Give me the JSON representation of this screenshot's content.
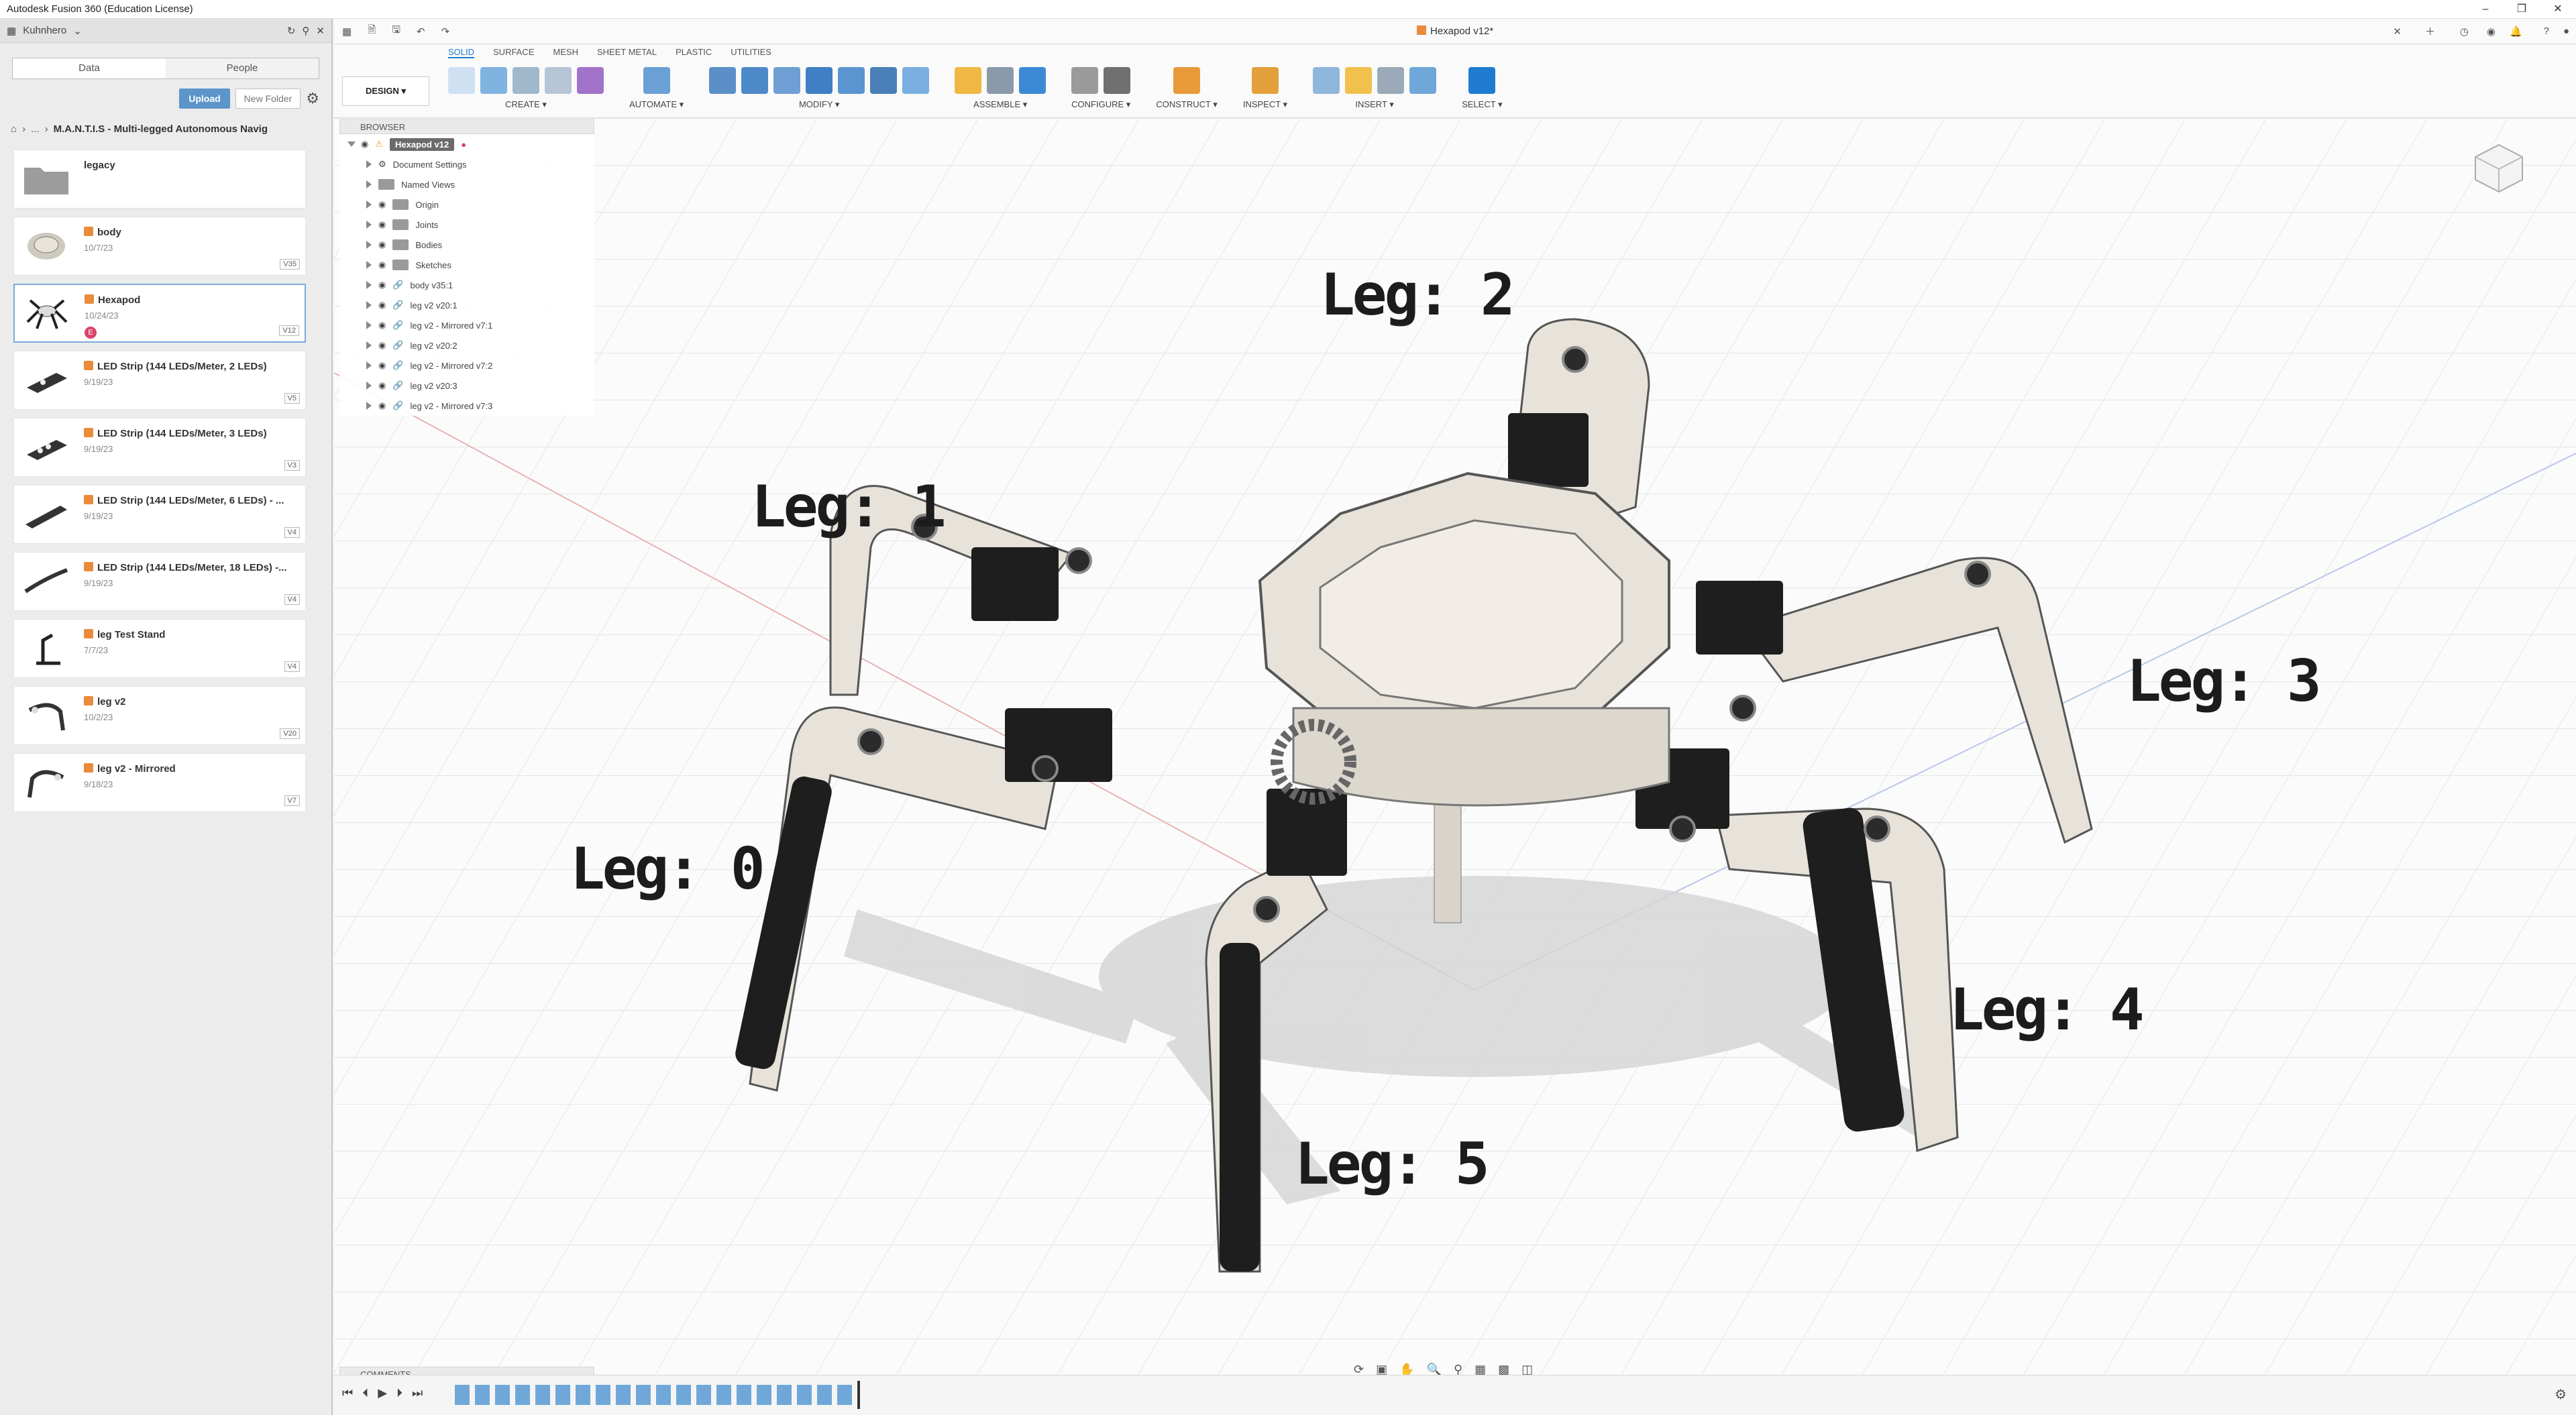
{
  "window": {
    "title": "Autodesk Fusion 360 (Education License)"
  },
  "data_panel": {
    "user": "Kuhnhero",
    "tabs": [
      "Data",
      "People"
    ],
    "upload_label": "Upload",
    "new_folder_label": "New Folder",
    "breadcrumb_ellipsis": "...",
    "breadcrumb_project": "M.A.N.T.I.S - Multi-legged Autonomous Navig",
    "items": [
      {
        "name": "legacy",
        "date": "",
        "version": "",
        "kind": "folder"
      },
      {
        "name": "body",
        "date": "10/7/23",
        "version": "V35"
      },
      {
        "name": "Hexapod",
        "date": "10/24/23",
        "version": "V12",
        "selected": true,
        "badge": "E"
      },
      {
        "name": "LED Strip (144 LEDs/Meter, 2 LEDs)",
        "date": "9/19/23",
        "version": "V5"
      },
      {
        "name": "LED Strip (144 LEDs/Meter, 3 LEDs)",
        "date": "9/19/23",
        "version": "V3"
      },
      {
        "name": "LED Strip (144 LEDs/Meter, 6 LEDs) - ...",
        "date": "9/19/23",
        "version": "V4"
      },
      {
        "name": "LED Strip (144 LEDs/Meter, 18 LEDs) -...",
        "date": "9/19/23",
        "version": "V4"
      },
      {
        "name": "leg Test Stand",
        "date": "7/7/23",
        "version": "V4"
      },
      {
        "name": "leg v2",
        "date": "10/2/23",
        "version": "V20"
      },
      {
        "name": "leg v2 - Mirrored",
        "date": "9/18/23",
        "version": "V7"
      }
    ]
  },
  "document": {
    "tab_title": "Hexapod v12*"
  },
  "toolbar": {
    "workspace": "DESIGN",
    "tabs": [
      "SOLID",
      "SURFACE",
      "MESH",
      "SHEET METAL",
      "PLASTIC",
      "UTILITIES"
    ],
    "active_tab": "SOLID",
    "groups": [
      "CREATE",
      "AUTOMATE",
      "MODIFY",
      "ASSEMBLE",
      "CONFIGURE",
      "CONSTRUCT",
      "INSPECT",
      "INSERT",
      "SELECT"
    ]
  },
  "browser": {
    "header": "BROWSER",
    "root": "Hexapod v12",
    "rows": [
      "Document Settings",
      "Named Views",
      "Origin",
      "Joints",
      "Bodies",
      "Sketches",
      "body v35:1",
      "leg v2 v20:1",
      "leg v2 - Mirrored v7:1",
      "leg v2 v20:2",
      "leg v2 - Mirrored v7:2",
      "leg v2 v20:3",
      "leg v2 - Mirrored v7:3"
    ]
  },
  "viewport": {
    "leg_labels": [
      "Leg: 0",
      "Leg: 1",
      "Leg: 2",
      "Leg: 3",
      "Leg: 4",
      "Leg: 5"
    ]
  },
  "comments": {
    "header": "COMMENTS"
  },
  "colors": {
    "accent": "#1f7cd1",
    "upload": "#5b95c9",
    "component_orange": "#e98b3a",
    "leg_white": "#e8e3da",
    "servo_black": "#1e1e1e"
  }
}
